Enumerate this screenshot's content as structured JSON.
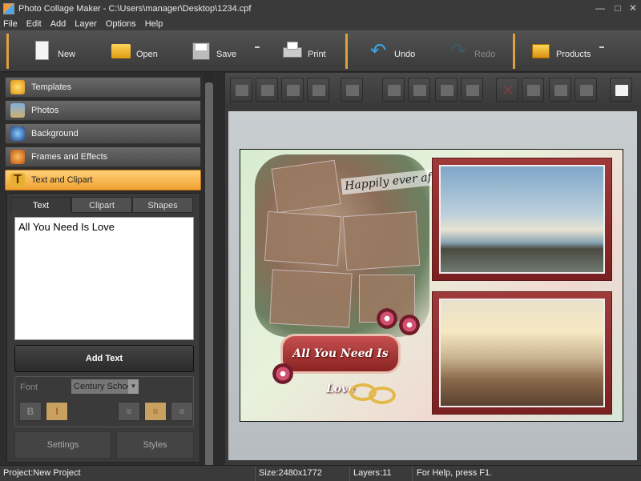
{
  "window": {
    "title": "Photo Collage Maker - C:\\Users\\manager\\Desktop\\1234.cpf"
  },
  "menu": [
    "File",
    "Edit",
    "Add",
    "Layer",
    "Options",
    "Help"
  ],
  "toolbar": {
    "new": "New",
    "open": "Open",
    "save": "Save",
    "print": "Print",
    "undo": "Undo",
    "redo": "Redo",
    "products": "Products"
  },
  "sidebar": {
    "items": [
      {
        "label": "Templates",
        "icon": "star-icon"
      },
      {
        "label": "Photos",
        "icon": "photos-icon"
      },
      {
        "label": "Background",
        "icon": "background-icon"
      },
      {
        "label": "Frames and Effects",
        "icon": "palette-icon"
      },
      {
        "label": "Text and Clipart",
        "icon": "text-icon",
        "active": true
      }
    ]
  },
  "tabs": [
    "Text",
    "Clipart",
    "Shapes"
  ],
  "text_input": "All You Need Is Love",
  "add_text": "Add Text",
  "font": {
    "label": "Font",
    "value": "Century Schoo",
    "bold": "B",
    "italic": "I"
  },
  "buttons": {
    "settings": "Settings",
    "styles": "Styles"
  },
  "canvas": {
    "banner_text": "All You Need Is Love",
    "happy_text": "Happily ever aft"
  },
  "colors": {
    "accent": "#f0a030",
    "frame": "#8a2a2a",
    "panel": "#2d2d2d"
  },
  "status": {
    "project": "Project:New Project",
    "size": "Size:2480x1772",
    "layers": "Layers:11",
    "help": "For Help, press F1."
  }
}
